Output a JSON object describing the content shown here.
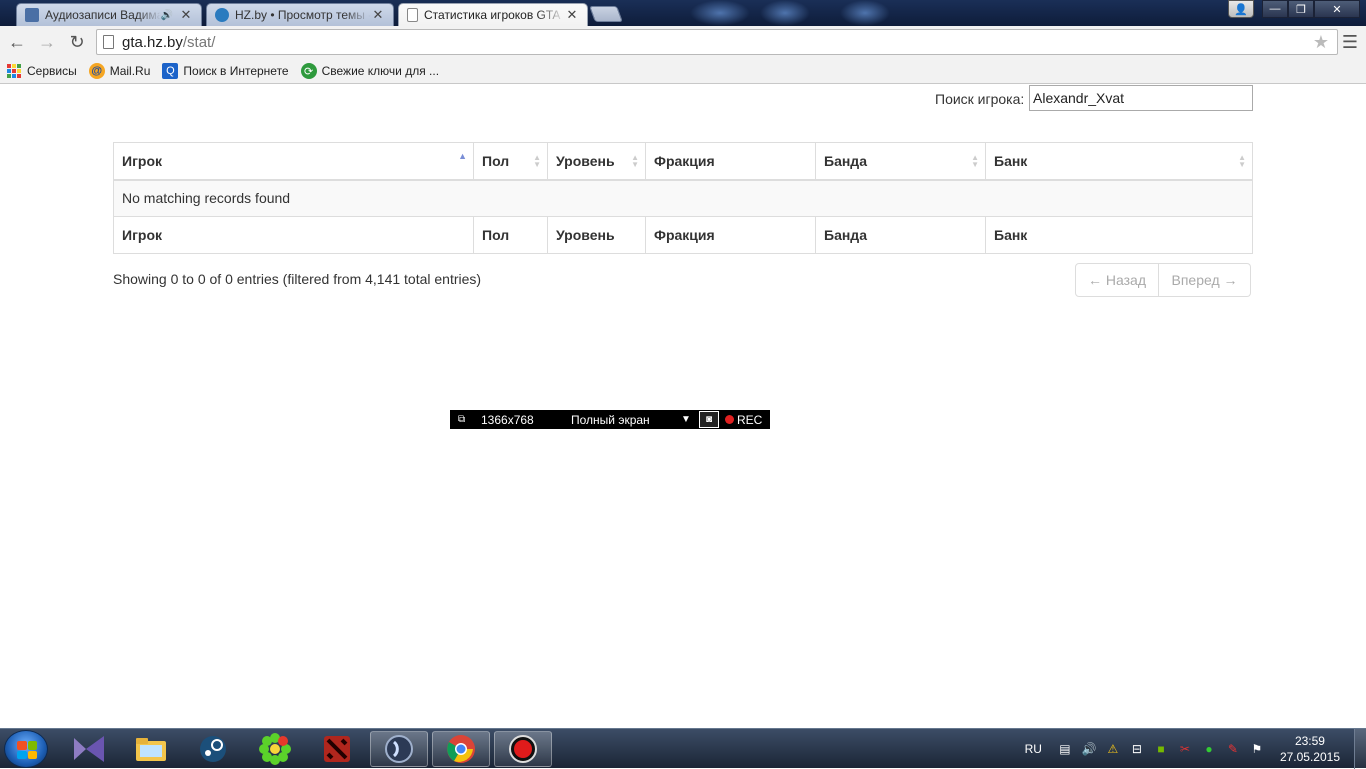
{
  "browser": {
    "tabs": [
      {
        "title": "Аудиозаписи Вадима",
        "has_audio": true,
        "active": false
      },
      {
        "title": "HZ.by • Просмотр темы - ",
        "has_audio": false,
        "active": false
      },
      {
        "title": "Статистика игроков GTA ",
        "has_audio": false,
        "active": true
      }
    ],
    "url_host": "gta.hz.by",
    "url_path": "/stat/",
    "bookmarks": [
      {
        "label": "Сервисы",
        "icon": "apps-grid-icon"
      },
      {
        "label": "Mail.Ru",
        "icon": "mailru-icon"
      },
      {
        "label": "Поиск в Интернете",
        "icon": "search-icon"
      },
      {
        "label": "Свежие ключи для ...",
        "icon": "key-site-icon"
      }
    ]
  },
  "page": {
    "search_label": "Поиск игрока:",
    "search_value": "Alexandr_Xvat",
    "columns": [
      "Игрок",
      "Пол",
      "Уровень",
      "Фракция",
      "Банда",
      "Банк"
    ],
    "empty_message": "No matching records found",
    "info": "Showing 0 to 0 of 0 entries (filtered from 4,141 total entries)",
    "pager": {
      "prev": "← Назад",
      "next": "Вперед →"
    }
  },
  "recorder": {
    "resolution": "1366x768",
    "mode": "Полный экран",
    "rec_label": "REC"
  },
  "taskbar": {
    "language": "RU",
    "time": "23:59",
    "date": "27.05.2015"
  },
  "colors": {
    "sort_active": "#7a8ed6",
    "rec_dot": "#e02020"
  }
}
